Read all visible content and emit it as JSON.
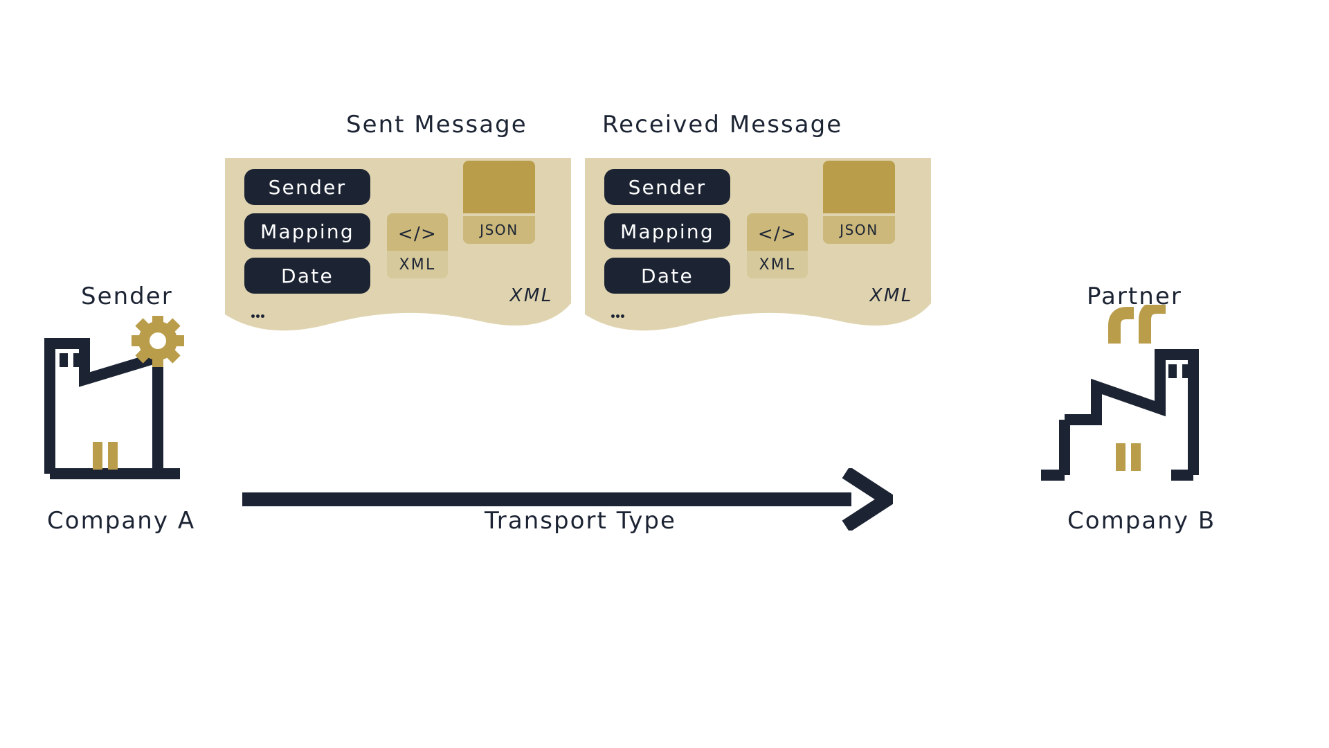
{
  "sender": {
    "role_label": "Sender",
    "company_label": "Company  A"
  },
  "partner": {
    "role_label": "Partner",
    "company_label": "Company  B"
  },
  "sent": {
    "title": "Sent Message",
    "fields": [
      "Sender",
      "Mapping",
      "Date"
    ],
    "xml_code": "</>",
    "xml_label": "XML",
    "json_label": "JSON",
    "format_badge": "XML"
  },
  "received": {
    "title": "Received Message",
    "fields": [
      "Sender",
      "Mapping",
      "Date"
    ],
    "xml_code": "</>",
    "xml_label": "XML",
    "json_label": "JSON",
    "format_badge": "XML"
  },
  "transport_label": "Transport Type"
}
